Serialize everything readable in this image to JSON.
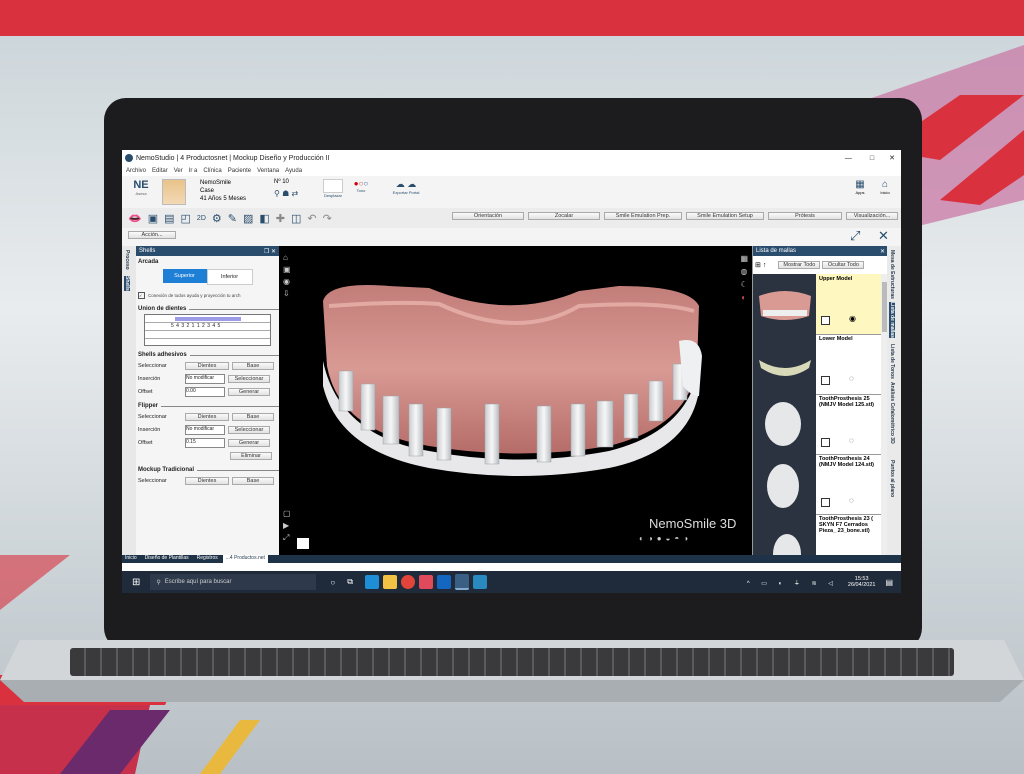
{
  "window": {
    "title": "NemoStudio  |  4 Productosnet | Mockup Diseño y Producción II"
  },
  "menu": [
    "Archivo",
    "Editar",
    "Ver",
    "Ir a",
    "Clínica",
    "Paciente",
    "Ventana",
    "Ayuda"
  ],
  "patient": {
    "initials": "NE",
    "initials_sub": "Asesa",
    "name": "NemoSmile",
    "case_label": "Case",
    "age": "41 Años 5 Meses",
    "number": "Nº 10"
  },
  "header": {
    "desplazar": "Desplazar",
    "tono": "Tono",
    "export_label": "Exportar Portal",
    "apps": "Apps",
    "home": "Inicio"
  },
  "subbar": {
    "accion": "Acción...",
    "buttons": [
      "Orientación",
      "Zocalar",
      "Smile Emulation Prep.",
      "Smile Emulation Setup",
      "Prótesis",
      "Visualización..."
    ]
  },
  "left_rail": [
    "Proceso",
    "Shells"
  ],
  "left_panel": {
    "title": "Shells",
    "arcada_label": "Arcada",
    "superior": "Superior",
    "inferior": "Inferior",
    "checkbox": "Conexión de todos ayuda y proyección tu arch",
    "union_label": "Union de dientes",
    "grid_row_1": "5  4  3  2  1  1  2  3  4  5",
    "shells_label": "Shells adhesivos",
    "seleccionar": "Seleccionar",
    "dientes": "Dientes",
    "base": "Base",
    "insercion": "Inserción",
    "no_modificar": "No modificar",
    "seleccionar_btn": "Seleccionar",
    "offset": "Offset",
    "offset_value": "0.00",
    "generar": "Generar",
    "flipper_label": "Flipper",
    "flipper_offset": "0.15",
    "eliminar": "Eliminar",
    "mockup_label": "Mockup Tradicional"
  },
  "viewport": {
    "brand": "NemoSmile 3D",
    "corner": "A"
  },
  "right_panel": {
    "title": "Lista de mallas",
    "mostrar": "Mostrar Todo",
    "ocultar": "Ocultar Todo",
    "items": [
      {
        "label": "Upper Model"
      },
      {
        "label": "Lower Model"
      },
      {
        "label": "ToothProsthesis 25 (NMJV Model 125.stl)"
      },
      {
        "label": "ToothProsthesis 24 (NMJV Model 124.stl)"
      },
      {
        "label": "ToothProsthesis 23 ( SKYN F7 Cerrados Pieza_ 23_bone.stl)"
      }
    ]
  },
  "right_rail": [
    "Mesa de Estructuras",
    "Lista de mallas",
    "Lista de Tonos",
    "Análisis Cefalométrico 3D",
    "Puntos al plano"
  ],
  "bottom_tabs": [
    "Inicio",
    "Diseño de Plantillas",
    "Registros",
    "...4 Productos.net"
  ],
  "taskbar": {
    "search": "Escribe aquí para buscar",
    "time": "15:53",
    "date": "26/04/2021"
  },
  "colors": {
    "brand_red": "#d9313d",
    "panel_blue": "#2a4d6e",
    "gum": "#d99a94"
  }
}
